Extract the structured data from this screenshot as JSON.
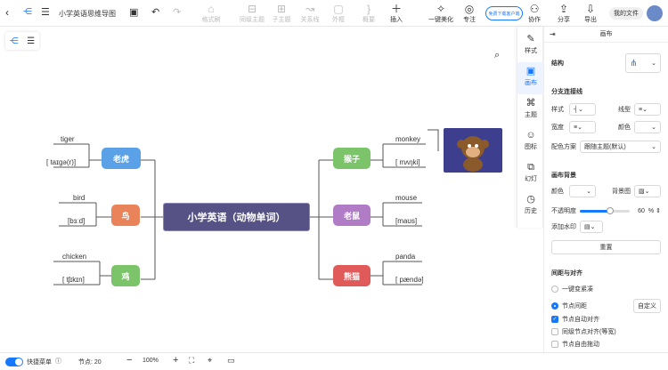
{
  "topbar": {
    "doc_title": "小学英语思维导图",
    "format_brush": "格式刷",
    "sibling_topic": "同级主题",
    "child_topic": "子主题",
    "relation": "关系线",
    "outline": "外框",
    "summary": "概要",
    "insert": "插入",
    "beautify": "一键美化",
    "focus": "专注",
    "promo_button": "免费下载客户端",
    "collaborate": "协作",
    "share": "分享",
    "export": "导出",
    "my_files": "我的文件"
  },
  "rail": {
    "items": [
      "样式",
      "画布",
      "主题",
      "图标",
      "幻灯",
      "历史"
    ]
  },
  "panel": {
    "title": "画布",
    "structure_label": "结构",
    "branch_section": "分支连接线",
    "style_label": "样式",
    "line_type_label": "线型",
    "width_label": "宽度",
    "color_label": "颜色",
    "color_scheme_label": "配色方案",
    "color_scheme_value": "跟随主题(默认)",
    "bg_section": "画布背景",
    "bg_color_label": "颜色",
    "bg_image_label": "背景图",
    "opacity_label": "不透明度",
    "opacity_value": "60",
    "opacity_unit": "%",
    "opacity_fraction": 0.6,
    "watermark_label": "添加水印",
    "reset_button": "重置",
    "spacing_section": "间距与对齐",
    "compact_option": "一键变紧凑",
    "node_spacing_option": "节点间距",
    "custom_button": "自定义",
    "auto_align": "节点自动对齐",
    "sibling_align": "同级节点对齐(等宽)",
    "free_drag": "节点自由拖动"
  },
  "bottombar": {
    "shortcut_menu": "快捷菜单",
    "node_count": "节点: 20",
    "zoom": "100%"
  },
  "mindmap": {
    "root": "小学英语（动物单词）",
    "left": [
      {
        "label": "老虎",
        "color": "#5ba1e8",
        "word": "tiger",
        "phonetic": "[ taɪɡə(r)]"
      },
      {
        "label": "鸟",
        "color": "#e9845a",
        "word": "bird",
        "phonetic": "[bɜːd]"
      },
      {
        "label": "鸡",
        "color": "#7bc46a",
        "word": "chicken",
        "phonetic": "[ tʃɪkɪn]"
      }
    ],
    "right": [
      {
        "label": "猴子",
        "color": "#7bc46a",
        "word": "monkey",
        "phonetic": "[ mʌŋki]"
      },
      {
        "label": "老鼠",
        "color": "#b07cc6",
        "word": "mouse",
        "phonetic": "[maʊs]"
      },
      {
        "label": "熊猫",
        "color": "#e05a5a",
        "word": "panda",
        "phonetic": "[ pændə]"
      }
    ],
    "root_color": "#565285"
  }
}
